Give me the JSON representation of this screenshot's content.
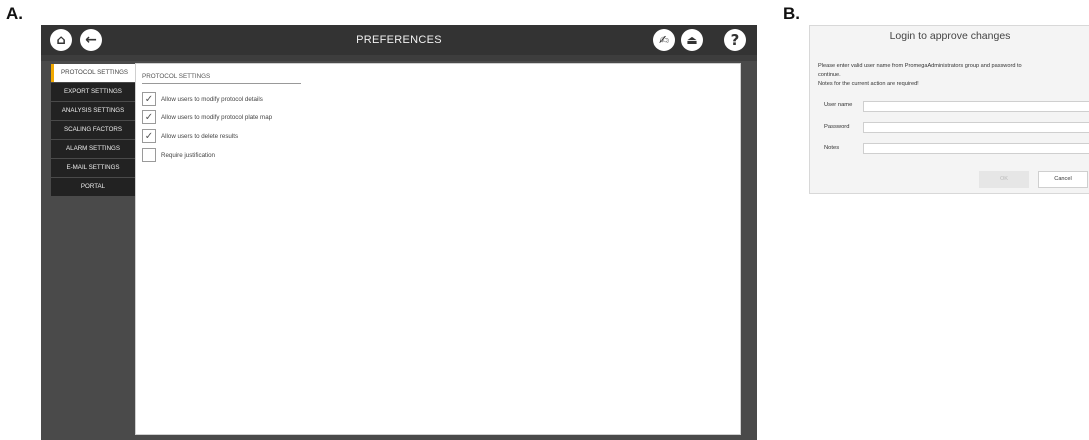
{
  "panel_labels": {
    "a": "A.",
    "b": "B."
  },
  "preferences": {
    "title": "PREFERENCES",
    "icons": {
      "home": "⌂",
      "back": "←",
      "sign": "✍",
      "exit": "⏏",
      "help": "?"
    },
    "sidebar": [
      {
        "label": "PROTOCOL SETTINGS",
        "active": true
      },
      {
        "label": "EXPORT SETTINGS"
      },
      {
        "label": "ANALYSIS SETTINGS"
      },
      {
        "label": "SCALING FACTORS"
      },
      {
        "label": "ALARM SETTINGS"
      },
      {
        "label": "E-MAIL SETTINGS"
      },
      {
        "label": "PORTAL"
      }
    ],
    "section_title": "PROTOCOL SETTINGS",
    "options": [
      {
        "label": "Allow users to modify protocol details",
        "checked": true,
        "mark": "✓"
      },
      {
        "label": "Allow users to modify protocol plate map",
        "checked": true,
        "mark": "✓"
      },
      {
        "label": "Allow users to delete results",
        "checked": true,
        "mark": "✓"
      },
      {
        "label": "Require justification",
        "checked": false,
        "mark": ""
      }
    ],
    "accent_color": "#f0a800"
  },
  "login_dialog": {
    "title": "Login to approve changes",
    "message_line1": "Please enter valid user name from PromegaAdministrators group and password to",
    "message_line2": "continue.",
    "message_line3": "Notes for the current action are required!",
    "fields": [
      {
        "label": "User name",
        "value": ""
      },
      {
        "label": "Password",
        "value": ""
      },
      {
        "label": "Notes",
        "value": ""
      }
    ],
    "ok_label": "OK",
    "cancel_label": "Cancel"
  }
}
